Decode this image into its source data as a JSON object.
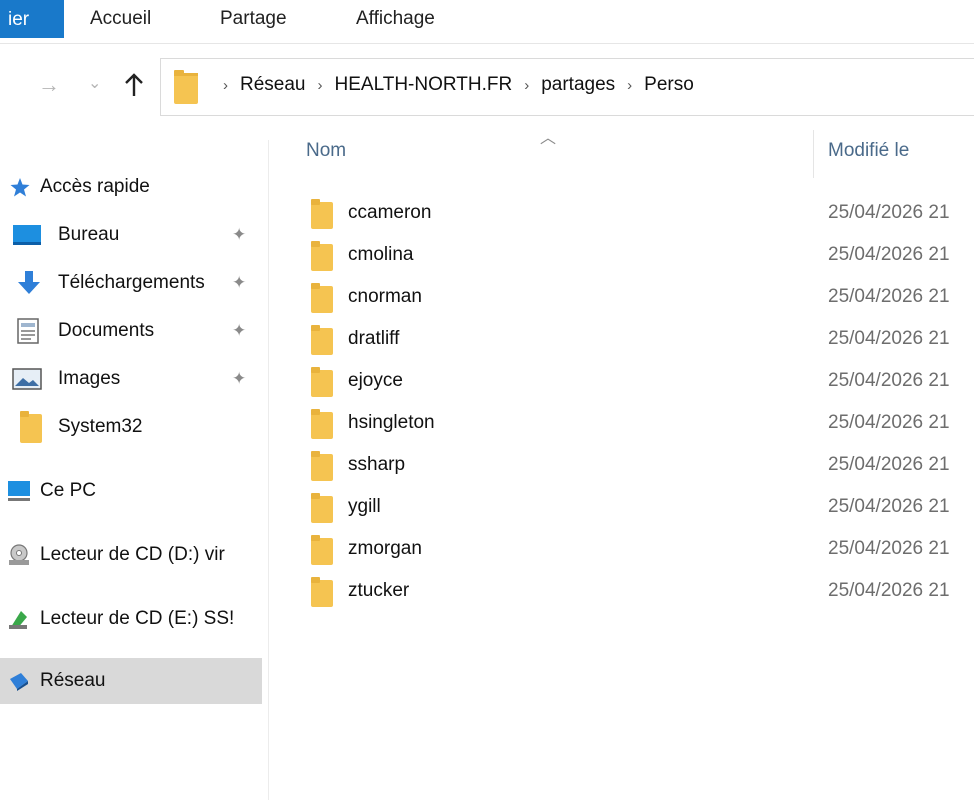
{
  "ribbon": {
    "file_tab": "ier",
    "tabs": [
      "Accueil",
      "Partage",
      "Affichage"
    ]
  },
  "nav": {
    "back_icon": "arrow-left-icon",
    "forward_icon": "arrow-right-icon",
    "recent_icon": "chevron-down-icon",
    "up_icon": "arrow-up-icon"
  },
  "address": {
    "crumbs": [
      "Réseau",
      "HEALTH-NORTH.FR",
      "partages",
      "Perso"
    ]
  },
  "sidebar": {
    "items": [
      {
        "label": "Accès rapide",
        "icon": "star-icon",
        "pinned": false
      },
      {
        "label": "Bureau",
        "icon": "desktop-icon",
        "pinned": true
      },
      {
        "label": "Téléchargements",
        "icon": "download-icon",
        "pinned": true
      },
      {
        "label": "Documents",
        "icon": "document-icon",
        "pinned": true
      },
      {
        "label": "Images",
        "icon": "image-icon",
        "pinned": true
      },
      {
        "label": "System32",
        "icon": "folder-icon",
        "pinned": false
      },
      {
        "label": "Ce PC",
        "icon": "computer-icon",
        "pinned": false
      },
      {
        "label": "Lecteur de CD (D:) vir",
        "icon": "cd-drive-icon",
        "pinned": false
      },
      {
        "label": "Lecteur de CD (E:) SS!",
        "icon": "cd-drive-icon",
        "pinned": false
      },
      {
        "label": "Réseau",
        "icon": "network-icon",
        "pinned": false,
        "selected": true
      }
    ]
  },
  "columns": {
    "name": "Nom",
    "modified": "Modifié le"
  },
  "files": [
    {
      "name": "ccameron",
      "modified": "25/04/2026 21"
    },
    {
      "name": "cmolina",
      "modified": "25/04/2026 21"
    },
    {
      "name": "cnorman",
      "modified": "25/04/2026 21"
    },
    {
      "name": "dratliff",
      "modified": "25/04/2026 21"
    },
    {
      "name": "ejoyce",
      "modified": "25/04/2026 21"
    },
    {
      "name": "hsingleton",
      "modified": "25/04/2026 21"
    },
    {
      "name": "ssharp",
      "modified": "25/04/2026 21"
    },
    {
      "name": "ygill",
      "modified": "25/04/2026 21"
    },
    {
      "name": "zmorgan",
      "modified": "25/04/2026 21"
    },
    {
      "name": "ztucker",
      "modified": "25/04/2026 21"
    }
  ],
  "colors": {
    "accent": "#1979ca",
    "folder": "#f5c451",
    "selected": "#d9d9d9"
  }
}
